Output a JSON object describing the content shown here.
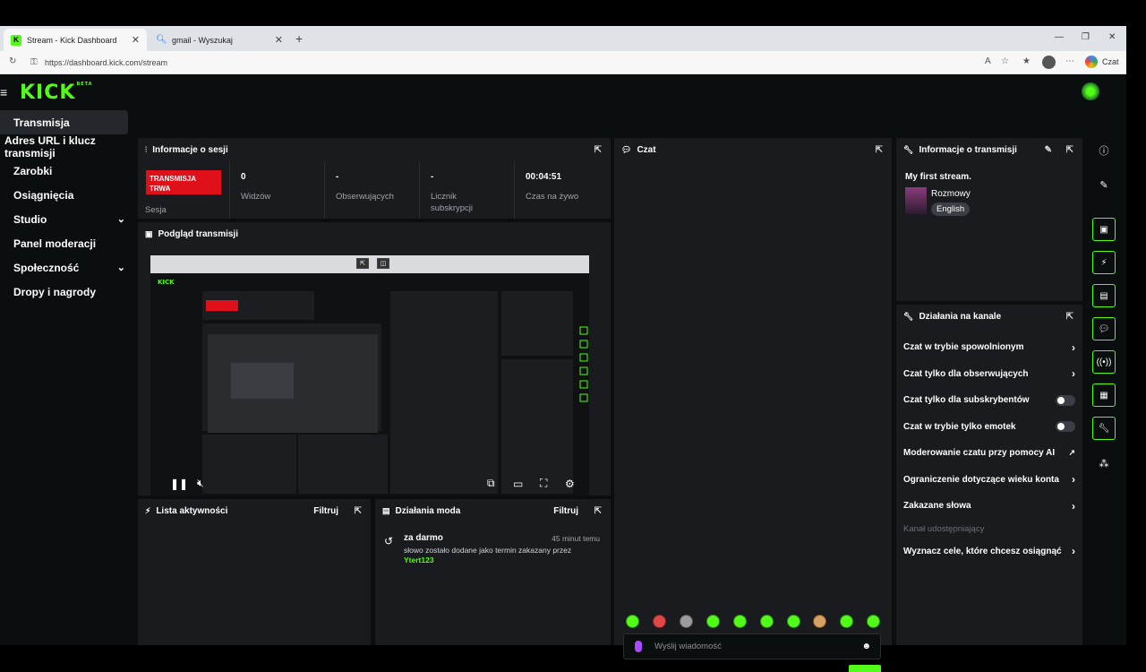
{
  "browser": {
    "tabs": [
      {
        "label": "Stream - Kick Dashboard",
        "active": true
      },
      {
        "label": "gmail - Wyszukaj",
        "active": false
      }
    ],
    "url": "https://dashboard.kick.com/stream",
    "copilot_label": "Czat"
  },
  "app": {
    "logo": "KICK",
    "logo_badge": "BETA"
  },
  "sidebar": {
    "items": [
      {
        "label": "Transmisja",
        "active": true
      },
      {
        "label": "Adres URL i klucz transmisji"
      },
      {
        "label": "Zarobki"
      },
      {
        "label": "Osiągnięcia"
      },
      {
        "label": "Studio",
        "expandable": true
      },
      {
        "label": "Panel moderacji"
      },
      {
        "label": "Społeczność",
        "expandable": true
      },
      {
        "label": "Dropy i nagrody"
      }
    ]
  },
  "session": {
    "title": "Informacje o sesji",
    "live_badge": "TRANSMISJA TRWA",
    "live_label": "Sesja",
    "stats": [
      {
        "value": "0",
        "label": "Widzów"
      },
      {
        "value": "-",
        "label": "Obserwujących"
      },
      {
        "value": "-",
        "label": "Licznik subskrypcji"
      },
      {
        "value": "00:04:51",
        "label": "Czas na żywo"
      }
    ]
  },
  "preview": {
    "title": "Podgląd transmisji"
  },
  "activity": {
    "title": "Lista aktywności",
    "filter": "Filtruj"
  },
  "mod_actions": {
    "title": "Działania moda",
    "filter": "Filtruj",
    "entries": [
      {
        "term": "za darmo",
        "time": "45 minut temu",
        "description": "słowo zostało dodane jako termin zakazany przez",
        "user": "Ytert123"
      }
    ]
  },
  "chat": {
    "title": "Czat",
    "placeholder": "Wyślij wiadomość"
  },
  "stream_info": {
    "title": "Informacje o transmisji",
    "stream_title": "My first stream.",
    "category": "Rozmowy",
    "language": "English"
  },
  "channel_actions": {
    "title": "Działania na kanale",
    "items": [
      {
        "label": "Czat w trybie spowolnionym",
        "control": "chevron"
      },
      {
        "label": "Czat tylko dla obserwujących",
        "control": "chevron"
      },
      {
        "label": "Czat tylko dla subskrybentów",
        "control": "toggle"
      },
      {
        "label": "Czat w trybie tylko emotek",
        "control": "toggle"
      },
      {
        "label": "Moderowanie czatu przy pomocy AI",
        "control": "external"
      },
      {
        "label": "Ograniczenie dotyczące wieku konta",
        "control": "chevron"
      },
      {
        "label": "Zakazane słowa",
        "control": "chevron"
      },
      {
        "label": "Kanał udostępniający",
        "control": "none",
        "muted": true
      },
      {
        "label": "Wyznacz cele, które chcesz osiągnąć",
        "control": "chevron"
      }
    ]
  },
  "colors": {
    "accent": "#53fc18",
    "live": "#e0101a",
    "panel": "#191b1f",
    "background": "#0b0e0f"
  }
}
